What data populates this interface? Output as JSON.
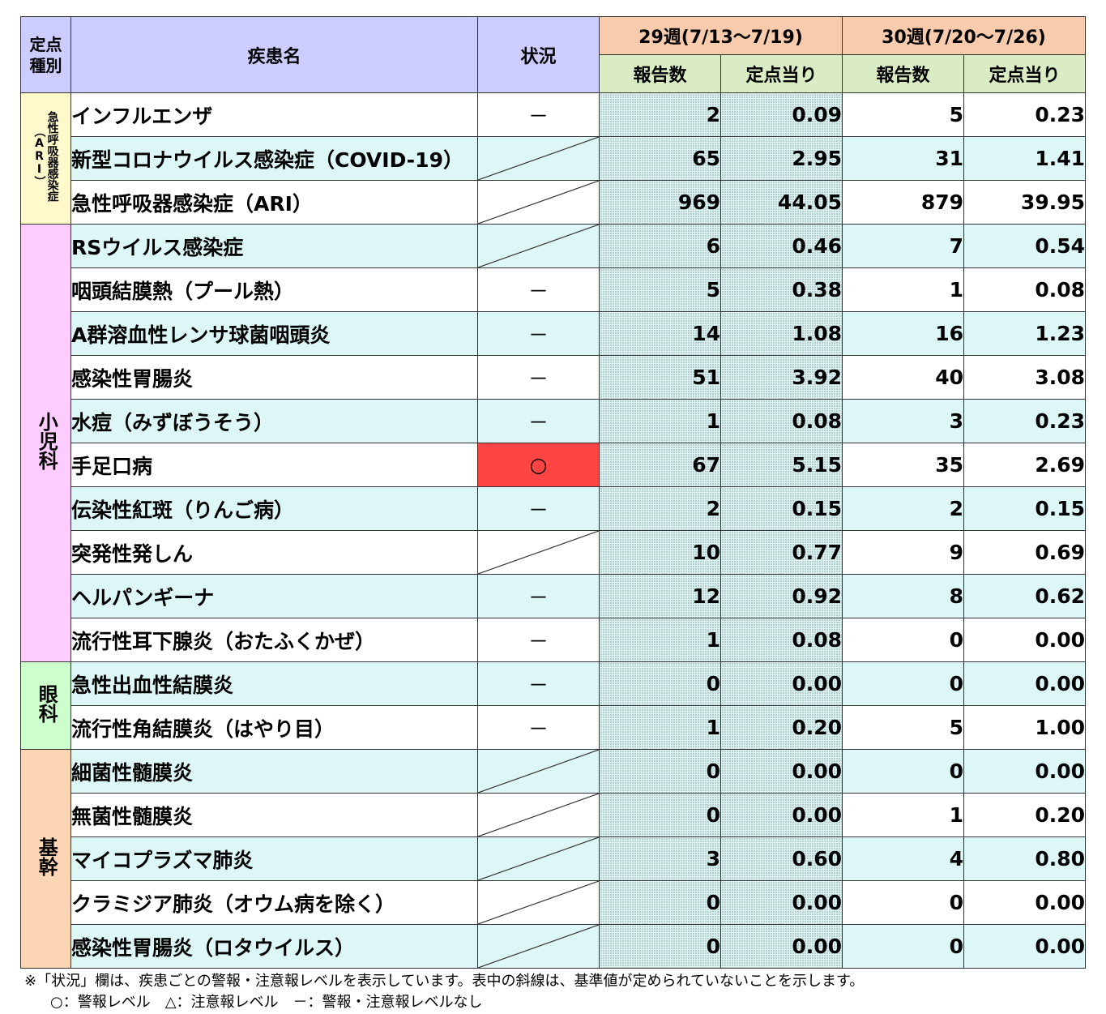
{
  "headers": {
    "category": "定点種別",
    "disease": "疾患名",
    "status": "状況",
    "week29": "29週(7/13～7/19)",
    "week30": "30週(7/20～7/26)",
    "reports": "報告数",
    "per_site": "定点当り"
  },
  "categories": [
    {
      "label": "急性呼吸器感染症（ARI）",
      "class": "cat-ari",
      "rows": 3,
      "font": 14
    },
    {
      "label": "小児科",
      "class": "cat-ped",
      "rows": 10,
      "font": 24
    },
    {
      "label": "眼科",
      "class": "cat-eye",
      "rows": 2,
      "font": 24
    },
    {
      "label": "基幹",
      "class": "cat-base",
      "rows": 5,
      "font": 24
    }
  ],
  "rows": [
    {
      "name": "インフルエンザ",
      "status": "－",
      "w29_reports": "2",
      "w29_per": "0.09",
      "w30_reports": "5",
      "w30_per": "0.23"
    },
    {
      "name": "新型コロナウイルス感染症（COVID-19）",
      "status": "",
      "w29_reports": "65",
      "w29_per": "2.95",
      "w30_reports": "31",
      "w30_per": "1.41"
    },
    {
      "name": "急性呼吸器感染症（ARI）",
      "status": "",
      "w29_reports": "969",
      "w29_per": "44.05",
      "w30_reports": "879",
      "w30_per": "39.95"
    },
    {
      "name": "RSウイルス感染症",
      "status": "",
      "w29_reports": "6",
      "w29_per": "0.46",
      "w30_reports": "7",
      "w30_per": "0.54"
    },
    {
      "name": "咽頭結膜熱（プール熱）",
      "status": "－",
      "w29_reports": "5",
      "w29_per": "0.38",
      "w30_reports": "1",
      "w30_per": "0.08"
    },
    {
      "name": "A群溶血性レンサ球菌咽頭炎",
      "status": "－",
      "w29_reports": "14",
      "w29_per": "1.08",
      "w30_reports": "16",
      "w30_per": "1.23"
    },
    {
      "name": "感染性胃腸炎",
      "status": "－",
      "w29_reports": "51",
      "w29_per": "3.92",
      "w30_reports": "40",
      "w30_per": "3.08"
    },
    {
      "name": "水痘（みずぼうそう）",
      "status": "－",
      "w29_reports": "1",
      "w29_per": "0.08",
      "w30_reports": "3",
      "w30_per": "0.23"
    },
    {
      "name": "手足口病",
      "status": "○",
      "alarm": true,
      "w29_reports": "67",
      "w29_per": "5.15",
      "w30_reports": "35",
      "w30_per": "2.69"
    },
    {
      "name": "伝染性紅斑（りんご病）",
      "status": "－",
      "w29_reports": "2",
      "w29_per": "0.15",
      "w30_reports": "2",
      "w30_per": "0.15"
    },
    {
      "name": "突発性発しん",
      "status": "",
      "w29_reports": "10",
      "w29_per": "0.77",
      "w30_reports": "9",
      "w30_per": "0.69"
    },
    {
      "name": "ヘルパンギーナ",
      "status": "－",
      "w29_reports": "12",
      "w29_per": "0.92",
      "w30_reports": "8",
      "w30_per": "0.62"
    },
    {
      "name": "流行性耳下腺炎（おたふくかぜ）",
      "status": "－",
      "w29_reports": "1",
      "w29_per": "0.08",
      "w30_reports": "0",
      "w30_per": "0.00"
    },
    {
      "name": "急性出血性結膜炎",
      "status": "－",
      "w29_reports": "0",
      "w29_per": "0.00",
      "w30_reports": "0",
      "w30_per": "0.00"
    },
    {
      "name": "流行性角結膜炎（はやり目）",
      "status": "－",
      "w29_reports": "1",
      "w29_per": "0.20",
      "w30_reports": "5",
      "w30_per": "1.00"
    },
    {
      "name": "細菌性髄膜炎",
      "status": "",
      "w29_reports": "0",
      "w29_per": "0.00",
      "w30_reports": "0",
      "w30_per": "0.00"
    },
    {
      "name": "無菌性髄膜炎",
      "status": "",
      "w29_reports": "0",
      "w29_per": "0.00",
      "w30_reports": "1",
      "w30_per": "0.20"
    },
    {
      "name": "マイコプラズマ肺炎",
      "status": "",
      "w29_reports": "3",
      "w29_per": "0.60",
      "w30_reports": "4",
      "w30_per": "0.80"
    },
    {
      "name": "クラミジア肺炎（オウム病を除く）",
      "status": "",
      "w29_reports": "0",
      "w29_per": "0.00",
      "w30_reports": "0",
      "w30_per": "0.00"
    },
    {
      "name": "感染性胃腸炎（ロタウイルス）",
      "status": "",
      "w29_reports": "0",
      "w29_per": "0.00",
      "w30_reports": "0",
      "w30_per": "0.00"
    }
  ],
  "footnote": {
    "line1": "※「状況」欄は、疾患ごとの警報・注意報レベルを表示しています。表中の斜線は、基準値が定められていないことを示します。",
    "line2": "○：警報レベル　△：注意報レベル　－：警報・注意報レベルなし"
  }
}
